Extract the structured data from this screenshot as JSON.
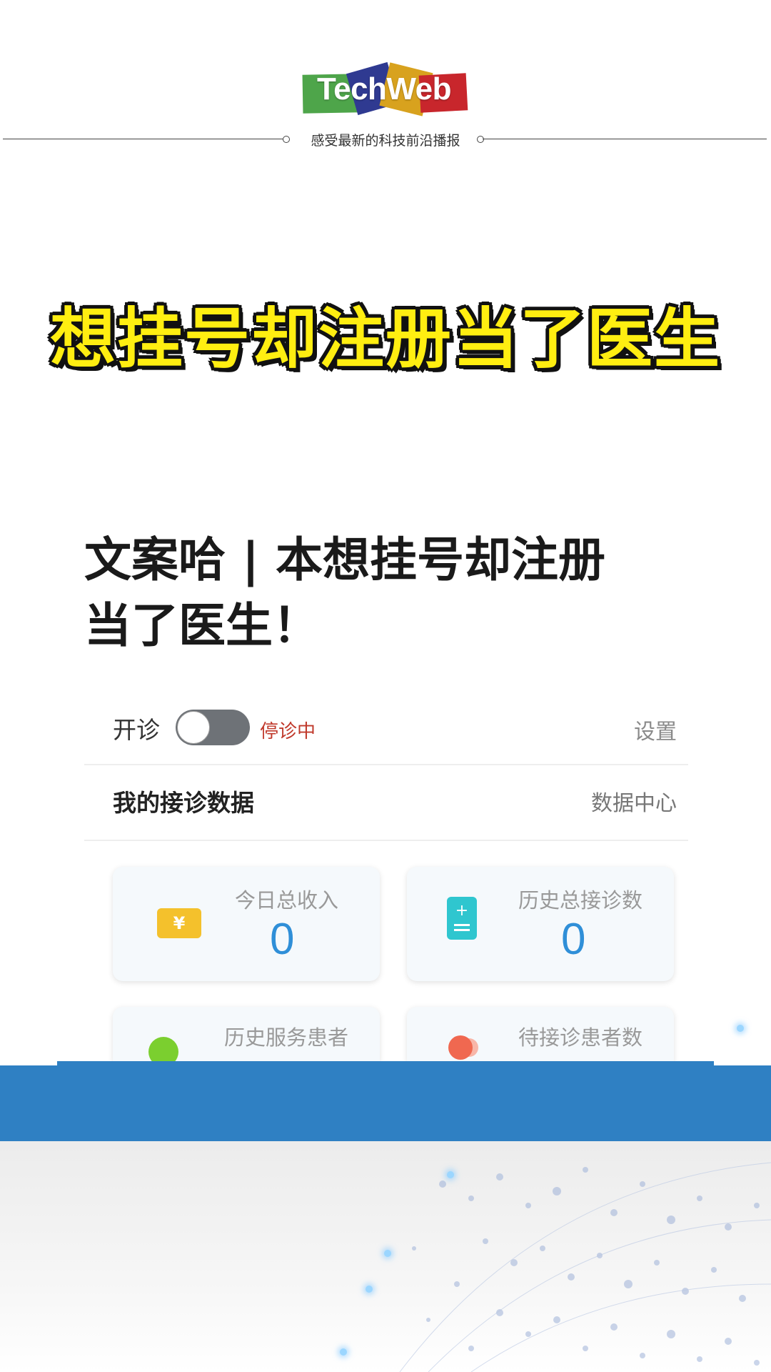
{
  "header": {
    "logo_text": "TechWeb",
    "tagline": "感受最新的科技前沿播报"
  },
  "headline": "想挂号却注册当了医生",
  "article": {
    "title_line1": "文案哈 | 本想挂号却注册",
    "title_line2": "当了医生！"
  },
  "app": {
    "status": {
      "label": "开诊",
      "toggle_on": false,
      "state": "停诊中",
      "settings": "设置"
    },
    "section": {
      "title": "我的接诊数据",
      "link": "数据中心"
    },
    "cards": [
      {
        "label": "今日总收入",
        "value": "0",
        "icon": "yen-ticket-icon"
      },
      {
        "label": "历史总接诊数",
        "value": "0",
        "icon": "clipboard-plus-icon"
      },
      {
        "label": "历史服务患者",
        "icon": "patients-icon"
      },
      {
        "label": "待接诊患者数",
        "icon": "waiting-patients-icon"
      }
    ]
  },
  "colors": {
    "headline_fill": "#ffee11",
    "value_blue": "#2f8fd8",
    "band_blue": "#2f80c3",
    "stop_red": "#c0392b"
  }
}
